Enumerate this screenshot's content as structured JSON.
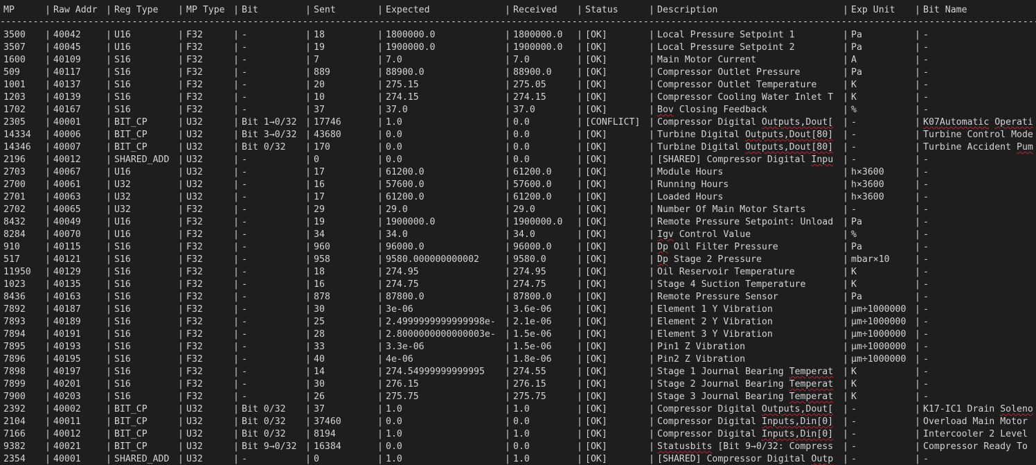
{
  "headers": [
    "MP",
    "Raw Addr",
    "Reg Type",
    "MP Type",
    "Bit",
    "Sent",
    "Expected",
    "Received",
    "Status",
    "Description",
    "Exp Unit",
    "Bit Name"
  ],
  "divider": "---------------------------------------------------------------------------------------------------------------------------------------------------------------------------------------------------------------------------",
  "rows": [
    [
      "3500",
      "40042",
      "U16",
      "F32",
      "-",
      "18",
      "1800000.0",
      "1800000.0",
      "[OK]",
      "Local Pressure Setpoint 1",
      "Pa",
      "-"
    ],
    [
      "3507",
      "40045",
      "U16",
      "F32",
      "-",
      "19",
      "1900000.0",
      "1900000.0",
      "[OK]",
      "Local Pressure Setpoint 2",
      "Pa",
      "-"
    ],
    [
      "1600",
      "40109",
      "S16",
      "F32",
      "-",
      "7",
      "7.0",
      "7.0",
      "[OK]",
      "Main Motor Current",
      "A",
      "-"
    ],
    [
      "509",
      "40117",
      "S16",
      "F32",
      "-",
      "889",
      "88900.0",
      "88900.0",
      "[OK]",
      "Compressor Outlet Pressure",
      "Pa",
      "-"
    ],
    [
      "1001",
      "40137",
      "S16",
      "F32",
      "-",
      "20",
      "275.15",
      "275.05",
      "[OK]",
      "Compressor Outlet Temperature",
      "K",
      "-"
    ],
    [
      "1203",
      "40139",
      "S16",
      "F32",
      "-",
      "10",
      "274.15",
      "274.15",
      "[OK]",
      "Compressor Cooling Water Inlet T",
      "K",
      "-"
    ],
    [
      "1702",
      "40167",
      "S16",
      "F32",
      "-",
      "37",
      "37.0",
      "37.0",
      "[OK]",
      "Bov Closing Feedback",
      "%",
      "-"
    ],
    [
      "2305",
      "40001",
      "BIT_CP",
      "U32",
      "Bit 1→0/32",
      "17746",
      "1.0",
      "0.0",
      "[CONFLICT]",
      "Compressor Digital Outputs,Dout[",
      "-",
      "K07Automatic Operati"
    ],
    [
      "14334",
      "40006",
      "BIT_CP",
      "U32",
      "Bit 3→0/32",
      "43680",
      "0.0",
      "0.0",
      "[OK]",
      "Turbine Digital Outputs,Dout[80]",
      "-",
      "Turbine Control Mode"
    ],
    [
      "14346",
      "40007",
      "BIT_CP",
      "U32",
      "Bit 0/32",
      "170",
      "0.0",
      "0.0",
      "[OK]",
      "Turbine Digital Outputs,Dout[80]",
      "-",
      "Turbine Accident Pum"
    ],
    [
      "2196",
      "40012",
      "SHARED_ADD",
      "U32",
      "-",
      "0",
      "0.0",
      "0.0",
      "[OK]",
      "[SHARED] Compressor Digital Inpu",
      "-",
      "-"
    ],
    [
      "2703",
      "40067",
      "U16",
      "U32",
      "-",
      "17",
      "61200.0",
      "61200.0",
      "[OK]",
      "Module Hours",
      "h×3600",
      "-"
    ],
    [
      "2700",
      "40061",
      "U32",
      "U32",
      "-",
      "16",
      "57600.0",
      "57600.0",
      "[OK]",
      "Running Hours",
      "h×3600",
      "-"
    ],
    [
      "2701",
      "40063",
      "U32",
      "U32",
      "-",
      "17",
      "61200.0",
      "61200.0",
      "[OK]",
      "Loaded Hours",
      "h×3600",
      "-"
    ],
    [
      "2702",
      "40065",
      "U32",
      "F32",
      "-",
      "29",
      "29.0",
      "29.0",
      "[OK]",
      "Number Of Main Motor Starts",
      "-",
      "-"
    ],
    [
      "8432",
      "40049",
      "U16",
      "F32",
      "-",
      "19",
      "1900000.0",
      "1900000.0",
      "[OK]",
      "Remote Pressure Setpoint: Unload",
      "Pa",
      "-"
    ],
    [
      "8284",
      "40070",
      "U16",
      "F32",
      "-",
      "34",
      "34.0",
      "34.0",
      "[OK]",
      "Igv Control Value",
      "%",
      "-"
    ],
    [
      "910",
      "40115",
      "S16",
      "F32",
      "-",
      "960",
      "96000.0",
      "96000.0",
      "[OK]",
      "Dp Oil Filter Pressure",
      "Pa",
      "-"
    ],
    [
      "517",
      "40121",
      "S16",
      "F32",
      "-",
      "958",
      "9580.000000000002",
      "9580.0",
      "[OK]",
      "Dp Stage 2 Pressure",
      "mbar×10",
      "-"
    ],
    [
      "11950",
      "40129",
      "S16",
      "F32",
      "-",
      "18",
      "274.95",
      "274.95",
      "[OK]",
      "Oil Reservoir Temperature",
      "K",
      "-"
    ],
    [
      "1023",
      "40135",
      "S16",
      "F32",
      "-",
      "16",
      "274.75",
      "274.75",
      "[OK]",
      "Stage 4 Suction Temperature",
      "K",
      "-"
    ],
    [
      "8436",
      "40163",
      "S16",
      "F32",
      "-",
      "878",
      "87800.0",
      "87800.0",
      "[OK]",
      "Remote Pressure Sensor",
      "Pa",
      "-"
    ],
    [
      "7892",
      "40187",
      "S16",
      "F32",
      "-",
      "30",
      "3e-06",
      "3.6e-06",
      "[OK]",
      "Element 1 Y Vibration",
      "µm÷1000000",
      "-"
    ],
    [
      "7893",
      "40189",
      "S16",
      "F32",
      "-",
      "25",
      "2.4999999999999998e-",
      "2.1e-06",
      "[OK]",
      "Element 2 Y Vibration",
      "µm÷1000000",
      "-"
    ],
    [
      "7894",
      "40191",
      "S16",
      "F32",
      "-",
      "28",
      "2.8000000000000003e-",
      "1.5e-06",
      "[OK]",
      "Element 3 Y Vibration",
      "µm÷1000000",
      "-"
    ],
    [
      "7895",
      "40193",
      "S16",
      "F32",
      "-",
      "33",
      "3.3e-06",
      "1.5e-06",
      "[OK]",
      "Pin1 Z Vibration",
      "µm÷1000000",
      "-"
    ],
    [
      "7896",
      "40195",
      "S16",
      "F32",
      "-",
      "40",
      "4e-06",
      "1.8e-06",
      "[OK]",
      "Pin2 Z Vibration",
      "µm÷1000000",
      "-"
    ],
    [
      "7898",
      "40197",
      "S16",
      "F32",
      "-",
      "14",
      "274.54999999999995",
      "274.55",
      "[OK]",
      "Stage 1 Journal Bearing Temperat",
      "K",
      "-"
    ],
    [
      "7899",
      "40201",
      "S16",
      "F32",
      "-",
      "30",
      "276.15",
      "276.15",
      "[OK]",
      "Stage 2 Journal Bearing Temperat",
      "K",
      "-"
    ],
    [
      "7900",
      "40203",
      "S16",
      "F32",
      "-",
      "26",
      "275.75",
      "275.75",
      "[OK]",
      "Stage 3 Journal Bearing Temperat",
      "K",
      "-"
    ],
    [
      "2392",
      "40002",
      "BIT_CP",
      "U32",
      "Bit 0/32",
      "37",
      "1.0",
      "1.0",
      "[OK]",
      "Compressor Digital Outputs,Dout[",
      "-",
      "K17-IC1 Drain Soleno"
    ],
    [
      "2104",
      "40011",
      "BIT_CP",
      "U32",
      "Bit 0/32",
      "37460",
      "0.0",
      "0.0",
      "[OK]",
      "Compressor Digital Inputs,Din[0]",
      "-",
      "Overload Main Motor"
    ],
    [
      "7166",
      "40012",
      "BIT_CP",
      "U32",
      "Bit 0/32",
      "8194",
      "1.0",
      "1.0",
      "[OK]",
      "Compressor Digital Inputs,Din[0]",
      "-",
      "Intercooler 2 Level"
    ],
    [
      "9382",
      "40021",
      "BIT_CP",
      "U32",
      "Bit 9→0/32",
      "16384",
      "0.0",
      "0.0",
      "[OK]",
      "Statusbits [Bit 9→0/32: Compress",
      "-",
      "Compressor Ready To"
    ],
    [
      "2354",
      "40001",
      "SHARED_ADD",
      "U32",
      "-",
      "0",
      "1.0",
      "1.0",
      "[OK]",
      "[SHARED] Compressor Digital Outp",
      "-",
      "-"
    ]
  ],
  "wavy_words": [
    "Igv",
    "Dp",
    "Bov",
    "Outputs,Dout[",
    "Outputs,Dout[80]",
    "Inputs,Din[0]",
    "Inpu",
    "Outp",
    "Statusbits",
    "Temperat",
    "K07Automatic",
    "Operati",
    "Soleno",
    "Pum"
  ]
}
